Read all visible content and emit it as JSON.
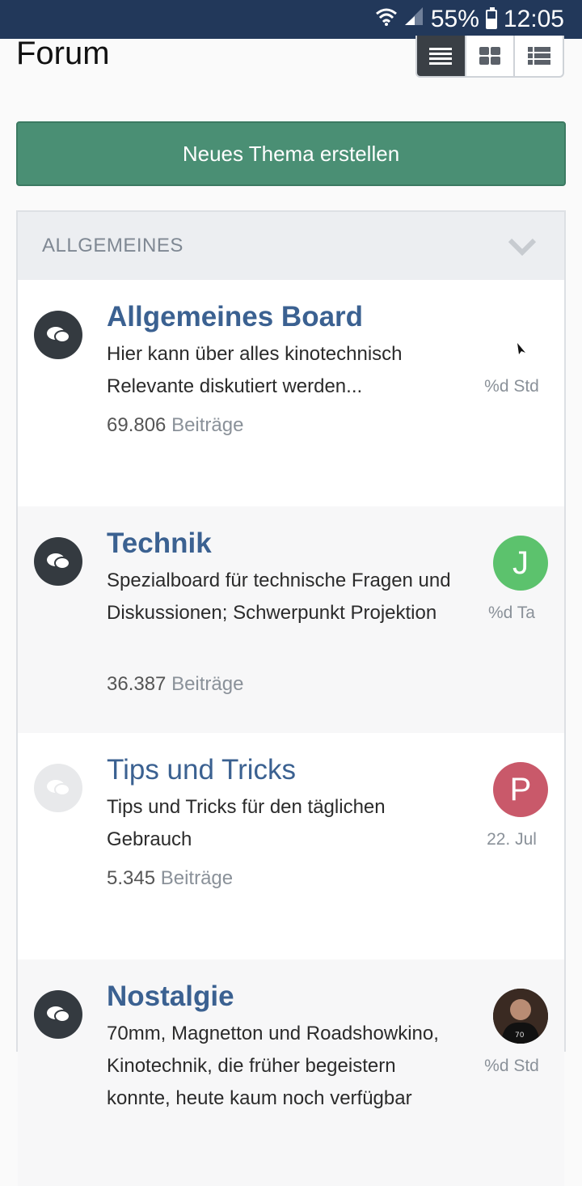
{
  "status_bar": {
    "battery": "55%",
    "time": "12:05",
    "battery_level": 0.55,
    "icons": [
      "wifi-icon",
      "signal-icon",
      "battery-icon"
    ]
  },
  "page": {
    "title": "Forum"
  },
  "view_toggle": {
    "options": [
      "list-view-icon",
      "grid-view-icon",
      "detailed-list-icon"
    ],
    "selected": "list-view-icon"
  },
  "new_topic_button": {
    "label": "Neues Thema erstellen",
    "color": "#4a8f74"
  },
  "section": {
    "title": "ALLGEMEINES",
    "boards": [
      {
        "title": "Allgemeines Board",
        "description": "Hier kann über alles kinotechnisch Relevante diskutiert werden...",
        "count": "69.806",
        "count_label": "Beiträge",
        "last_time": "%d Std",
        "avatar_letter": "",
        "avatar_color": "",
        "unread": true
      },
      {
        "title": "Technik",
        "description": "Spezialboard für technische Fragen und Diskussionen; Schwerpunkt Projektion",
        "count": "36.387",
        "count_label": "Beiträge",
        "last_time": "%d Ta",
        "avatar_letter": "J",
        "avatar_color": "#5cc26d",
        "unread": true
      },
      {
        "title": "Tips und Tricks",
        "description": "Tips und Tricks für den täglichen Gebrauch",
        "count": "5.345",
        "count_label": "Beiträge",
        "last_time": "22. Jul",
        "avatar_letter": "P",
        "avatar_color": "#c9596a",
        "unread": false
      },
      {
        "title": "Nostalgie",
        "description": "70mm, Magnetton und Roadshowkino, Kinotechnik, die früher begeistern konnte, heute kaum noch verfügbar",
        "count": "",
        "count_label": "",
        "last_time": "%d Std",
        "avatar_letter": "",
        "avatar_color": "",
        "unread": true
      }
    ]
  }
}
